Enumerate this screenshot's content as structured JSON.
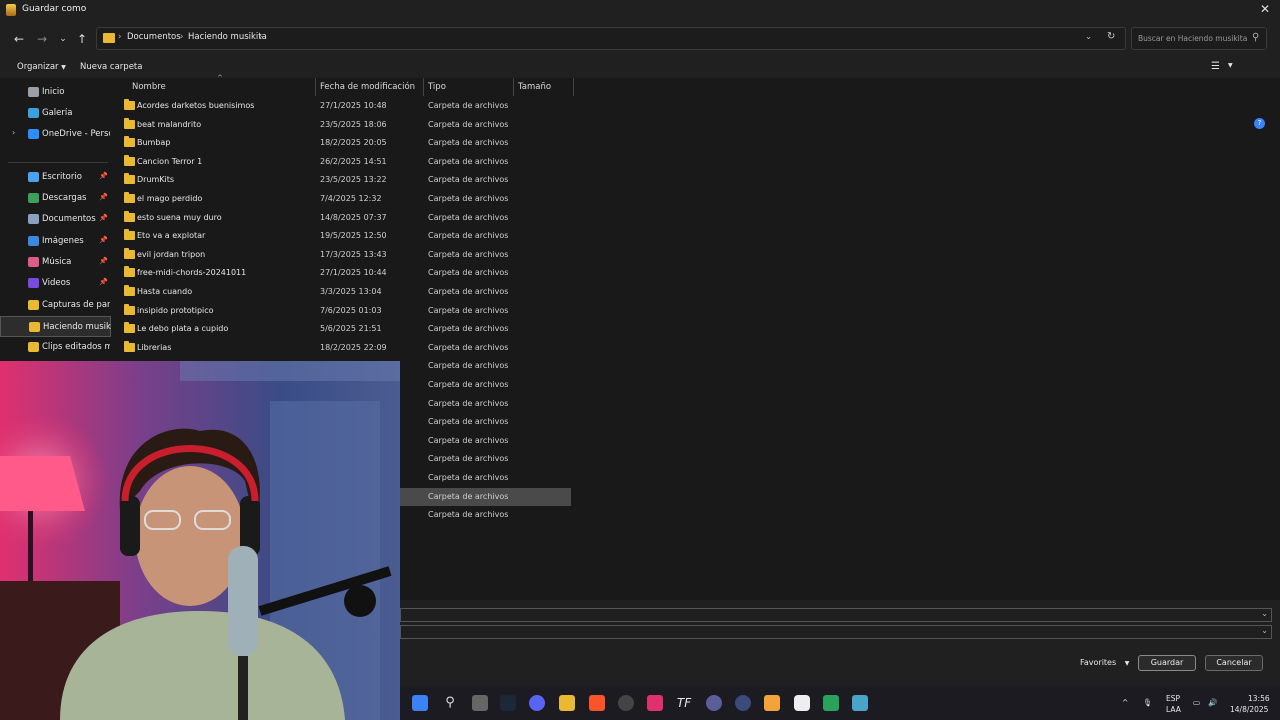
{
  "window": {
    "title": "Guardar como"
  },
  "address": {
    "segments": [
      "Documentos",
      "Haciendo musikita"
    ],
    "search_placeholder": "Buscar en Haciendo musikita"
  },
  "toolbar": {
    "organize": "Organizar",
    "new_folder": "Nueva carpeta"
  },
  "sidebar": {
    "items": [
      {
        "label": "Inicio",
        "icon": "home-icon",
        "pinned": false
      },
      {
        "label": "Galería",
        "icon": "gallery-icon",
        "pinned": false
      },
      {
        "label": "OneDrive - Persona",
        "icon": "cloud-icon",
        "pinned": false
      },
      {
        "label": "Escritorio",
        "icon": "desktop-icon",
        "pinned": true
      },
      {
        "label": "Descargas",
        "icon": "download-icon",
        "pinned": true
      },
      {
        "label": "Documentos",
        "icon": "document-icon",
        "pinned": true
      },
      {
        "label": "Imágenes",
        "icon": "image-icon",
        "pinned": true
      },
      {
        "label": "Música",
        "icon": "music-icon",
        "pinned": true
      },
      {
        "label": "Videos",
        "icon": "video-icon",
        "pinned": true
      },
      {
        "label": "Capturas de pantall",
        "icon": "folder-icon",
        "pinned": false
      },
      {
        "label": "Haciendo musikita",
        "icon": "folder-icon",
        "pinned": false
      },
      {
        "label": "Clips editados mar",
        "icon": "folder-icon",
        "pinned": false
      }
    ]
  },
  "columns": {
    "name": "Nombre",
    "modified": "Fecha de modificación",
    "type": "Tipo",
    "size": "Tamaño"
  },
  "files": [
    {
      "name": "Acordes darketos buenisimos",
      "date": "27/1/2025 10:48",
      "type": "Carpeta de archivos"
    },
    {
      "name": "beat malandrito",
      "date": "23/5/2025 18:06",
      "type": "Carpeta de archivos"
    },
    {
      "name": "Bumbap",
      "date": "18/2/2025 20:05",
      "type": "Carpeta de archivos"
    },
    {
      "name": "Cancion Terror 1",
      "date": "26/2/2025 14:51",
      "type": "Carpeta de archivos"
    },
    {
      "name": "DrumKits",
      "date": "23/5/2025 13:22",
      "type": "Carpeta de archivos"
    },
    {
      "name": "el mago perdido",
      "date": "7/4/2025 12:32",
      "type": "Carpeta de archivos"
    },
    {
      "name": "esto suena muy duro",
      "date": "14/8/2025 07:37",
      "type": "Carpeta de archivos"
    },
    {
      "name": "Eto va a explotar",
      "date": "19/5/2025 12:50",
      "type": "Carpeta de archivos"
    },
    {
      "name": "evil jordan tripon",
      "date": "17/3/2025 13:43",
      "type": "Carpeta de archivos"
    },
    {
      "name": "free-midi-chords-20241011",
      "date": "27/1/2025 10:44",
      "type": "Carpeta de archivos"
    },
    {
      "name": "Hasta cuando",
      "date": "3/3/2025 13:04",
      "type": "Carpeta de archivos"
    },
    {
      "name": "insipido prototipico",
      "date": "7/6/2025 01:03",
      "type": "Carpeta de archivos"
    },
    {
      "name": "Le debo plata a cupido",
      "date": "5/6/2025 21:51",
      "type": "Carpeta de archivos"
    },
    {
      "name": "Librerias",
      "date": "18/2/2025 22:09",
      "type": "Carpeta de archivos"
    },
    {
      "name": "",
      "date": "",
      "type": "Carpeta de archivos"
    },
    {
      "name": "",
      "date": "",
      "type": "Carpeta de archivos"
    },
    {
      "name": "",
      "date": "",
      "type": "Carpeta de archivos"
    },
    {
      "name": "",
      "date": "",
      "type": "Carpeta de archivos"
    },
    {
      "name": "",
      "date": "",
      "type": "Carpeta de archivos"
    },
    {
      "name": "",
      "date": "",
      "type": "Carpeta de archivos"
    },
    {
      "name": "",
      "date": "",
      "type": "Carpeta de archivos"
    },
    {
      "name": "",
      "date": "",
      "type": "Carpeta de archivos"
    },
    {
      "name": "",
      "date": "",
      "type": "Carpeta de archivos"
    }
  ],
  "selected_row": 21,
  "footer": {
    "favorites": "Favorites",
    "save": "Guardar",
    "cancel": "Cancelar"
  },
  "tray": {
    "lang1": "ESP",
    "lang2": "LAA",
    "time": "13:56",
    "date": "14/8/2025"
  },
  "colors": {
    "folder": "#e8b931",
    "accent": "#3b82f6"
  }
}
